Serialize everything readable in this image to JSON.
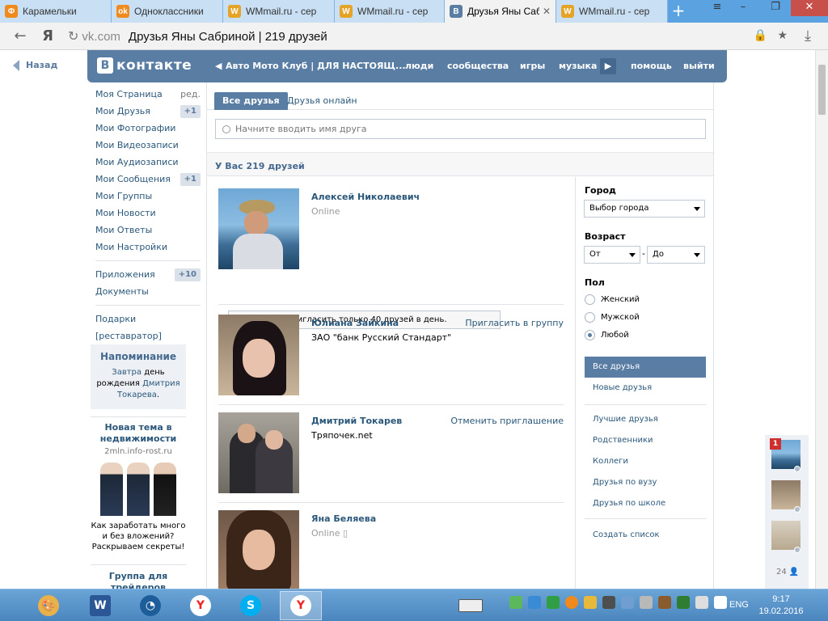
{
  "browser": {
    "tabs": [
      {
        "title": "Карамельки",
        "icon": "odnoklassniki-icon",
        "color": "#f08a1c",
        "glyph": "Ф"
      },
      {
        "title": "Одноклассники",
        "icon": "odnoklassniki-icon",
        "color": "#f08a1c",
        "glyph": "ok"
      },
      {
        "title": "WMmail.ru - сер",
        "icon": "wmmail-icon",
        "color": "#e5a428",
        "glyph": "W"
      },
      {
        "title": "WMmail.ru - сер",
        "icon": "wmmail-icon",
        "color": "#e5a428",
        "glyph": "W"
      },
      {
        "title": "Друзья Яны Саб",
        "icon": "vk-icon",
        "color": "#597da3",
        "glyph": "B"
      },
      {
        "title": "WMmail.ru - сер",
        "icon": "wmmail-icon",
        "color": "#e5a428",
        "glyph": "W"
      }
    ],
    "url_domain": "vk.com",
    "url_title": "Друзья Яны Сабриной | 219 друзей"
  },
  "page": {
    "back_label": "Назад",
    "logo_text": "контакте",
    "logo_letter": "В",
    "header_links": [
      "Авто Мото Клуб | ДЛЯ НАСТОЯЩ...",
      "люди",
      "сообщества",
      "игры",
      "музыка",
      "помощь",
      "выйти"
    ]
  },
  "left_menu": {
    "items": [
      {
        "label": "Моя Страница",
        "right": "ред."
      },
      {
        "label": "Мои Друзья",
        "badge": "+1"
      },
      {
        "label": "Мои Фотографии"
      },
      {
        "label": "Мои Видеозаписи"
      },
      {
        "label": "Мои Аудиозаписи"
      },
      {
        "label": "Мои Сообщения",
        "badge": "+1"
      },
      {
        "label": "Мои Группы"
      },
      {
        "label": "Мои Новости"
      },
      {
        "label": "Мои Ответы"
      },
      {
        "label": "Мои Настройки"
      }
    ],
    "items2": [
      {
        "label": "Приложения",
        "badge": "+10"
      },
      {
        "label": "Документы"
      }
    ],
    "items3": [
      {
        "label": "Подарки"
      },
      {
        "label": "[реставратор]"
      }
    ]
  },
  "reminder": {
    "title": "Напоминание",
    "text1": "Завтра",
    "text2": " день рождения ",
    "link": "Дмитрия Токарева",
    "text3": "."
  },
  "ad": {
    "title": "Новая тема в недвижимости",
    "domain": "2mln.info-rost.ru",
    "body": "Как заработать много и без вложений? Раскрываем секреты!",
    "next_title": "Группа для трейдеров"
  },
  "friends_tabs": [
    "Все друзья",
    "Друзья онлайн"
  ],
  "search_placeholder": "Начните вводить имя друга",
  "summary": "У Вас 219 друзей",
  "notice": "Вы можете пригласить только 40 друзей в день.",
  "friends": [
    {
      "name": "Алексей Николаевич",
      "sub": "Online",
      "action": ""
    },
    {
      "name": "Юлиана Зайкина",
      "sub": "ЗАО \"банк Русский Стандарт\"",
      "action": "Пригласить в группу"
    },
    {
      "name": "Дмитрий Токарев",
      "sub": "Тряпочек.net",
      "action": "Отменить приглашение"
    },
    {
      "name": "Яна Беляева",
      "sub": "Online ▯",
      "action": ""
    }
  ],
  "filters": {
    "city_label": "Город",
    "city_value": "Выбор города",
    "age_label": "Возраст",
    "age_from": "От",
    "age_dash": "-",
    "age_to": "До",
    "sex_label": "Пол",
    "sex_options": [
      "Женский",
      "Мужской",
      "Любой"
    ],
    "sex_selected": "Любой",
    "lists": [
      "Все друзья",
      "Новые друзья"
    ],
    "lists2": [
      "Лучшие друзья",
      "Родственники",
      "Коллеги",
      "Друзья по вузу",
      "Друзья по школе"
    ],
    "create_list": "Создать список"
  },
  "chat": {
    "unread": "1",
    "count": "24"
  },
  "taskbar": {
    "lang": "ENG",
    "time": "9:17",
    "date": "19.02.2016"
  }
}
